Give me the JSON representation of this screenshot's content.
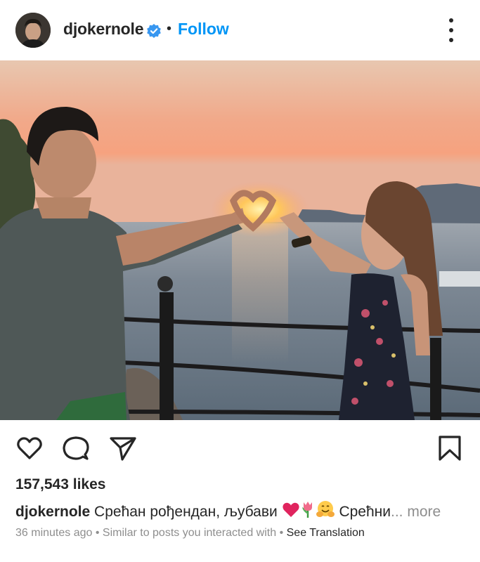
{
  "post": {
    "username": "djokernole",
    "separator": "•",
    "follow_label": "Follow",
    "likes": "157,543 likes",
    "caption": {
      "username": "djokernole",
      "text": "Срећан рођендан, љубави",
      "text_after_emoji": "Срећни",
      "ellipsis": "...",
      "more_label": "more"
    },
    "meta": {
      "time": "36 minutes ago",
      "dot": " • ",
      "similar": "Similar to posts you interacted with",
      "dot2": " • ",
      "see_translation": "See Translation"
    },
    "icons": {
      "menu": "more-options-icon",
      "like": "heart-icon",
      "comment": "comment-icon",
      "share": "send-icon",
      "save": "bookmark-icon",
      "verified": "verified-badge-icon"
    },
    "colors": {
      "accent": "#0095f6",
      "text": "#262626",
      "muted": "#8e8e8e",
      "emoji_heart": "#e0245e"
    }
  }
}
